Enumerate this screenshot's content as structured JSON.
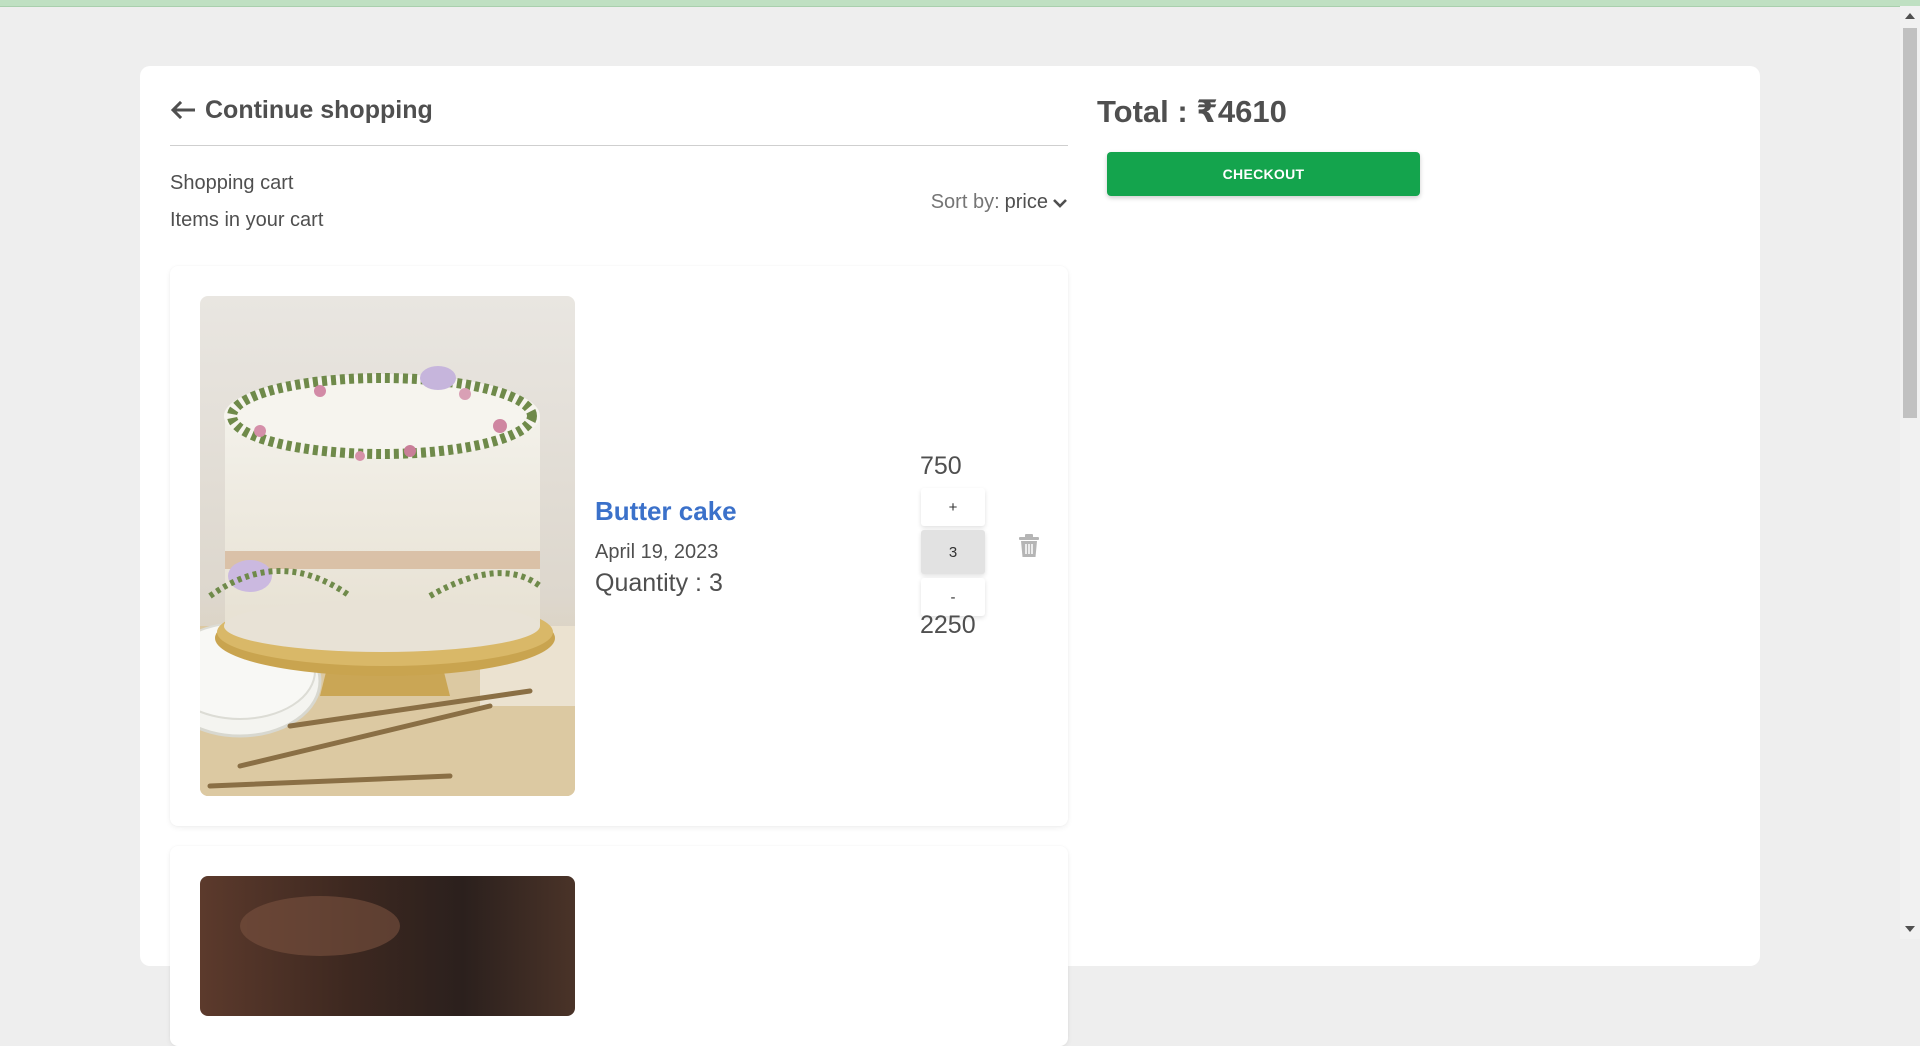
{
  "header": {
    "back_label": "Continue shopping"
  },
  "cart": {
    "title": "Shopping cart",
    "subtitle": "Items in your cart",
    "sort_label": "Sort by:",
    "sort_value": "price"
  },
  "items": [
    {
      "name": "Butter cake",
      "date": "April 19, 2023",
      "quantity_text": "Quantity : 3",
      "unit_price": "750",
      "stepper_plus": "+",
      "stepper_value": "3",
      "stepper_minus": "-",
      "line_total": "2250"
    }
  ],
  "summary": {
    "total": "Total : ₹4610",
    "checkout_label": "CHECKOUT"
  },
  "colors": {
    "accent_green": "#14a44d",
    "link_blue": "#3b71ca",
    "background": "#eeeeee"
  },
  "icons": {
    "back": "arrow-left-icon",
    "sort": "chevron-down-icon",
    "delete": "trash-icon"
  }
}
